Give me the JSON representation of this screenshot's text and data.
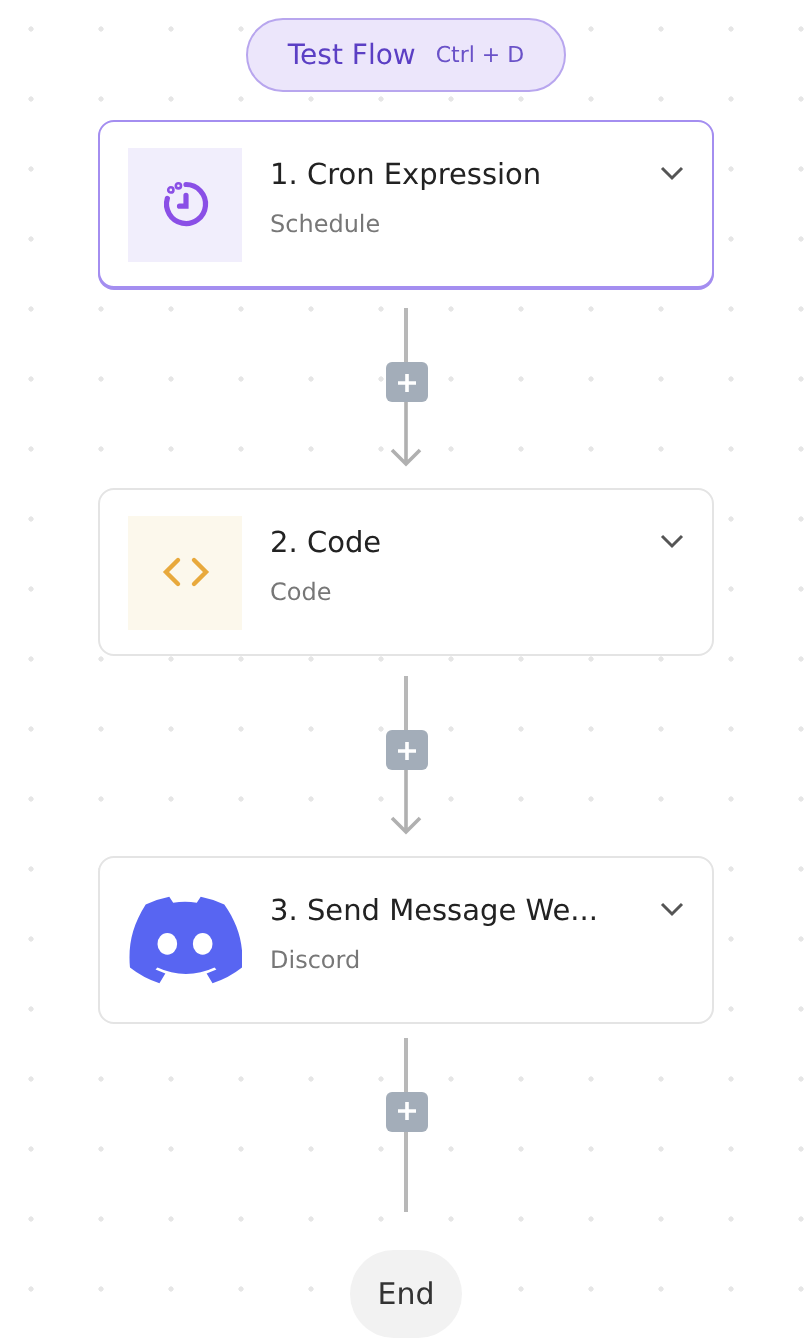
{
  "test_flow": {
    "label": "Test Flow",
    "shortcut": "Ctrl + D"
  },
  "steps": [
    {
      "kind": "schedule",
      "title": "1. Cron Expression",
      "subtitle": "Schedule",
      "selected": true
    },
    {
      "kind": "code",
      "title": "2. Code",
      "subtitle": "Code",
      "selected": false
    },
    {
      "kind": "discord",
      "title": "3. Send Message We...",
      "subtitle": "Discord",
      "selected": false
    }
  ],
  "end": {
    "label": "End"
  }
}
